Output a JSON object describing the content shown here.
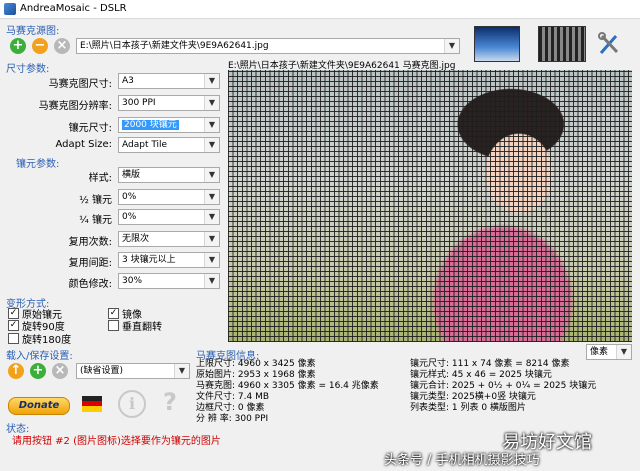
{
  "app": {
    "title": "AndreaMosaic - DSLR"
  },
  "source": {
    "section_label": "马赛克源图:",
    "path": "E:\\照片\\日本孩子\\新建文件夹\\9E9A62641.jpg",
    "preview_caption": "E:\\照片\\日本孩子\\新建文件夹\\9E9A62641 马赛克图.jpg"
  },
  "size_params": {
    "section_label": "尺寸参数:",
    "rows": [
      {
        "label": "马赛克图尺寸:",
        "value": "A3"
      },
      {
        "label": "马赛克图分辨率:",
        "value": "300 PPI"
      },
      {
        "label": "镶元尺寸:",
        "value": "2000 块镶元"
      },
      {
        "label": "Adapt Size:",
        "value": "Adapt Tile"
      }
    ]
  },
  "tile_params": {
    "section_label": "镶元参数:",
    "rows": [
      {
        "label": "样式:",
        "value": "横版"
      },
      {
        "label": "½ 镶元",
        "value": "0%"
      },
      {
        "label": "¼ 镶元",
        "value": "0%"
      },
      {
        "label": "复用次数:",
        "value": "无限次"
      },
      {
        "label": "复用间距:",
        "value": "3 块镶元以上"
      },
      {
        "label": "颜色修改:",
        "value": "30%"
      }
    ]
  },
  "transform": {
    "section_label": "变形方式:",
    "options": [
      {
        "label": "原始镶元",
        "checked": true
      },
      {
        "label": "镜像",
        "checked": true
      },
      {
        "label": "旋转90度",
        "checked": true
      },
      {
        "label": "垂直翻转",
        "checked": false
      },
      {
        "label": "旋转180度",
        "checked": false
      }
    ]
  },
  "load_save": {
    "section_label": "载入/保存设置:",
    "preset": "(缺省设置)"
  },
  "donate_label": "Donate",
  "info": {
    "section_label": "马赛克图信息:",
    "units_select": "像素",
    "left": [
      "上限尺寸: 4960 x 3425 像素",
      "原始图片: 2953 x 1968 像素",
      "马赛克图: 4960 x 3305 像素 = 16.4 兆像素",
      "文件尺寸: 7.4 MB",
      "边框尺寸: 0 像素",
      "分 辨 率: 300 PPI"
    ],
    "right": [
      "镶元尺寸: 111 x 74 像素 = 8214 像素",
      "镶元样式: 45 x 46 = 2025 块镶元",
      "镶元合计: 2025 + 0½ + 0¼ = 2025 块镶元",
      "镶元类型: 2025横+0竖 块镶元",
      "列表类型: 1 列表 0 横版图片"
    ]
  },
  "status": {
    "label": "状态:",
    "message": "请用按钮 #2 (图片图标)选择要作为镶元的图片"
  },
  "watermark": {
    "text1": "头条号 / 手机相机摄影技巧",
    "text2": "易坊好文馆"
  },
  "colors": {
    "accent_blue": "#2a5fb3",
    "status_red": "#d00000",
    "arrow_red": "#e01010",
    "selection": "#3399ff"
  }
}
